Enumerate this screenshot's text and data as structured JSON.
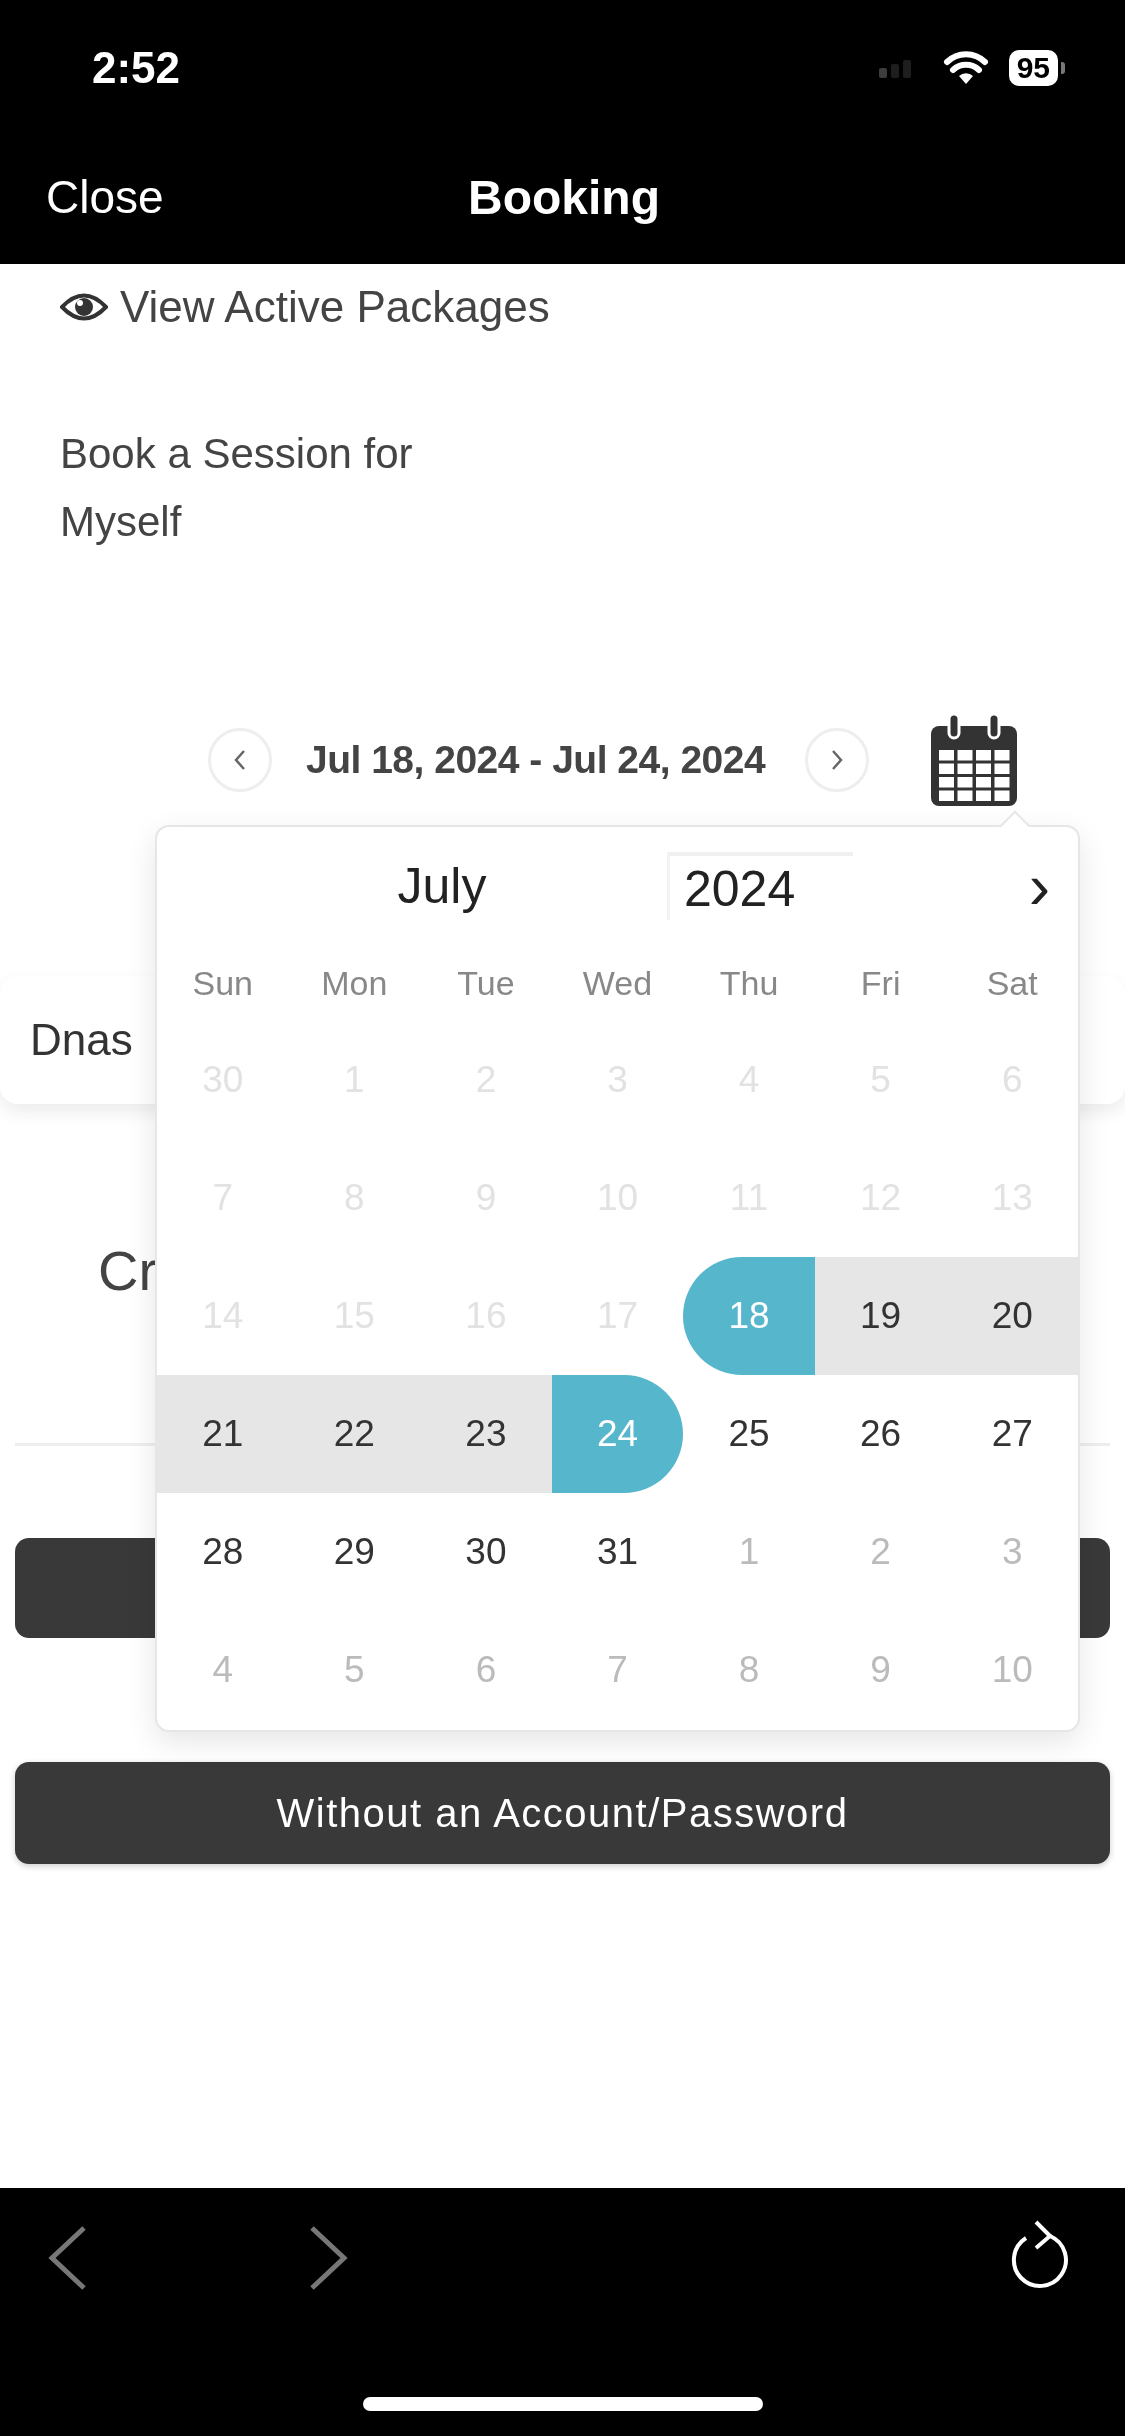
{
  "status_bar": {
    "time": "2:52",
    "battery": "95"
  },
  "nav_bar": {
    "close": "Close",
    "title": "Booking"
  },
  "packages_link": "View Active Packages",
  "book_label": "Book a Session for Myself",
  "date_range": {
    "label": "Jul 18, 2024 - Jul 24, 2024"
  },
  "card_text": "Dnas",
  "partial_text": "Cr",
  "account_button": "Without an Account/Password",
  "calendar": {
    "month": "July",
    "year": "2024",
    "next": "›",
    "weekdays": [
      "Sun",
      "Mon",
      "Tue",
      "Wed",
      "Thu",
      "Fri",
      "Sat"
    ],
    "weeks": [
      {
        "days": [
          {
            "day": "30",
            "kind": "disabled",
            "selected": false,
            "in_range": false
          },
          {
            "day": "1",
            "kind": "disabled",
            "selected": false,
            "in_range": false
          },
          {
            "day": "2",
            "kind": "disabled",
            "selected": false,
            "in_range": false
          },
          {
            "day": "3",
            "kind": "disabled",
            "selected": false,
            "in_range": false
          },
          {
            "day": "4",
            "kind": "disabled",
            "selected": false,
            "in_range": false
          },
          {
            "day": "5",
            "kind": "disabled",
            "selected": false,
            "in_range": false
          },
          {
            "day": "6",
            "kind": "disabled",
            "selected": false,
            "in_range": false
          }
        ]
      },
      {
        "days": [
          {
            "day": "7",
            "kind": "disabled",
            "selected": false,
            "in_range": false
          },
          {
            "day": "8",
            "kind": "disabled",
            "selected": false,
            "in_range": false
          },
          {
            "day": "9",
            "kind": "disabled",
            "selected": false,
            "in_range": false
          },
          {
            "day": "10",
            "kind": "disabled",
            "selected": false,
            "in_range": false
          },
          {
            "day": "11",
            "kind": "disabled",
            "selected": false,
            "in_range": false
          },
          {
            "day": "12",
            "kind": "disabled",
            "selected": false,
            "in_range": false
          },
          {
            "day": "13",
            "kind": "disabled",
            "selected": false,
            "in_range": false
          }
        ]
      },
      {
        "days": [
          {
            "day": "14",
            "kind": "disabled",
            "selected": false,
            "in_range": false
          },
          {
            "day": "15",
            "kind": "disabled",
            "selected": false,
            "in_range": false
          },
          {
            "day": "16",
            "kind": "disabled",
            "selected": false,
            "in_range": false
          },
          {
            "day": "17",
            "kind": "disabled",
            "selected": false,
            "in_range": false
          },
          {
            "day": "18",
            "kind": "normal",
            "selected": true,
            "in_range": true
          },
          {
            "day": "19",
            "kind": "normal",
            "selected": false,
            "in_range": true
          },
          {
            "day": "20",
            "kind": "normal",
            "selected": false,
            "in_range": true
          }
        ]
      },
      {
        "days": [
          {
            "day": "21",
            "kind": "normal",
            "selected": false,
            "in_range": true
          },
          {
            "day": "22",
            "kind": "normal",
            "selected": false,
            "in_range": true
          },
          {
            "day": "23",
            "kind": "normal",
            "selected": false,
            "in_range": true
          },
          {
            "day": "24",
            "kind": "normal",
            "selected": true,
            "in_range": true
          },
          {
            "day": "25",
            "kind": "normal",
            "selected": false,
            "in_range": false
          },
          {
            "day": "26",
            "kind": "normal",
            "selected": false,
            "in_range": false
          },
          {
            "day": "27",
            "kind": "normal",
            "selected": false,
            "in_range": false
          }
        ]
      },
      {
        "days": [
          {
            "day": "28",
            "kind": "normal",
            "selected": false,
            "in_range": false
          },
          {
            "day": "29",
            "kind": "normal",
            "selected": false,
            "in_range": false
          },
          {
            "day": "30",
            "kind": "normal",
            "selected": false,
            "in_range": false
          },
          {
            "day": "31",
            "kind": "normal",
            "selected": false,
            "in_range": false
          },
          {
            "day": "1",
            "kind": "outside",
            "selected": false,
            "in_range": false
          },
          {
            "day": "2",
            "kind": "outside",
            "selected": false,
            "in_range": false
          },
          {
            "day": "3",
            "kind": "outside",
            "selected": false,
            "in_range": false
          }
        ]
      },
      {
        "days": [
          {
            "day": "4",
            "kind": "outside",
            "selected": false,
            "in_range": false
          },
          {
            "day": "5",
            "kind": "outside",
            "selected": false,
            "in_range": false
          },
          {
            "day": "6",
            "kind": "outside",
            "selected": false,
            "in_range": false
          },
          {
            "day": "7",
            "kind": "outside",
            "selected": false,
            "in_range": false
          },
          {
            "day": "8",
            "kind": "outside",
            "selected": false,
            "in_range": false
          },
          {
            "day": "9",
            "kind": "outside",
            "selected": false,
            "in_range": false
          },
          {
            "day": "10",
            "kind": "outside",
            "selected": false,
            "in_range": false
          }
        ]
      }
    ]
  }
}
